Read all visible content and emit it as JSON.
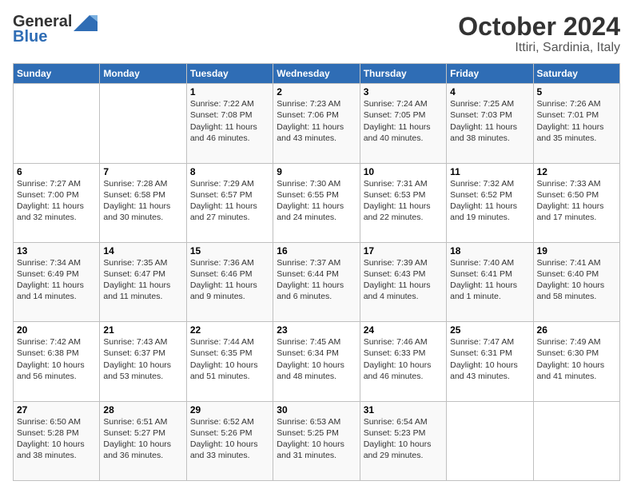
{
  "header": {
    "logo_line1": "General",
    "logo_line2": "Blue",
    "title": "October 2024",
    "subtitle": "Ittiri, Sardinia, Italy"
  },
  "weekdays": [
    "Sunday",
    "Monday",
    "Tuesday",
    "Wednesday",
    "Thursday",
    "Friday",
    "Saturday"
  ],
  "weeks": [
    [
      {
        "day": "",
        "info": ""
      },
      {
        "day": "",
        "info": ""
      },
      {
        "day": "1",
        "info": "Sunrise: 7:22 AM\nSunset: 7:08 PM\nDaylight: 11 hours and 46 minutes."
      },
      {
        "day": "2",
        "info": "Sunrise: 7:23 AM\nSunset: 7:06 PM\nDaylight: 11 hours and 43 minutes."
      },
      {
        "day": "3",
        "info": "Sunrise: 7:24 AM\nSunset: 7:05 PM\nDaylight: 11 hours and 40 minutes."
      },
      {
        "day": "4",
        "info": "Sunrise: 7:25 AM\nSunset: 7:03 PM\nDaylight: 11 hours and 38 minutes."
      },
      {
        "day": "5",
        "info": "Sunrise: 7:26 AM\nSunset: 7:01 PM\nDaylight: 11 hours and 35 minutes."
      }
    ],
    [
      {
        "day": "6",
        "info": "Sunrise: 7:27 AM\nSunset: 7:00 PM\nDaylight: 11 hours and 32 minutes."
      },
      {
        "day": "7",
        "info": "Sunrise: 7:28 AM\nSunset: 6:58 PM\nDaylight: 11 hours and 30 minutes."
      },
      {
        "day": "8",
        "info": "Sunrise: 7:29 AM\nSunset: 6:57 PM\nDaylight: 11 hours and 27 minutes."
      },
      {
        "day": "9",
        "info": "Sunrise: 7:30 AM\nSunset: 6:55 PM\nDaylight: 11 hours and 24 minutes."
      },
      {
        "day": "10",
        "info": "Sunrise: 7:31 AM\nSunset: 6:53 PM\nDaylight: 11 hours and 22 minutes."
      },
      {
        "day": "11",
        "info": "Sunrise: 7:32 AM\nSunset: 6:52 PM\nDaylight: 11 hours and 19 minutes."
      },
      {
        "day": "12",
        "info": "Sunrise: 7:33 AM\nSunset: 6:50 PM\nDaylight: 11 hours and 17 minutes."
      }
    ],
    [
      {
        "day": "13",
        "info": "Sunrise: 7:34 AM\nSunset: 6:49 PM\nDaylight: 11 hours and 14 minutes."
      },
      {
        "day": "14",
        "info": "Sunrise: 7:35 AM\nSunset: 6:47 PM\nDaylight: 11 hours and 11 minutes."
      },
      {
        "day": "15",
        "info": "Sunrise: 7:36 AM\nSunset: 6:46 PM\nDaylight: 11 hours and 9 minutes."
      },
      {
        "day": "16",
        "info": "Sunrise: 7:37 AM\nSunset: 6:44 PM\nDaylight: 11 hours and 6 minutes."
      },
      {
        "day": "17",
        "info": "Sunrise: 7:39 AM\nSunset: 6:43 PM\nDaylight: 11 hours and 4 minutes."
      },
      {
        "day": "18",
        "info": "Sunrise: 7:40 AM\nSunset: 6:41 PM\nDaylight: 11 hours and 1 minute."
      },
      {
        "day": "19",
        "info": "Sunrise: 7:41 AM\nSunset: 6:40 PM\nDaylight: 10 hours and 58 minutes."
      }
    ],
    [
      {
        "day": "20",
        "info": "Sunrise: 7:42 AM\nSunset: 6:38 PM\nDaylight: 10 hours and 56 minutes."
      },
      {
        "day": "21",
        "info": "Sunrise: 7:43 AM\nSunset: 6:37 PM\nDaylight: 10 hours and 53 minutes."
      },
      {
        "day": "22",
        "info": "Sunrise: 7:44 AM\nSunset: 6:35 PM\nDaylight: 10 hours and 51 minutes."
      },
      {
        "day": "23",
        "info": "Sunrise: 7:45 AM\nSunset: 6:34 PM\nDaylight: 10 hours and 48 minutes."
      },
      {
        "day": "24",
        "info": "Sunrise: 7:46 AM\nSunset: 6:33 PM\nDaylight: 10 hours and 46 minutes."
      },
      {
        "day": "25",
        "info": "Sunrise: 7:47 AM\nSunset: 6:31 PM\nDaylight: 10 hours and 43 minutes."
      },
      {
        "day": "26",
        "info": "Sunrise: 7:49 AM\nSunset: 6:30 PM\nDaylight: 10 hours and 41 minutes."
      }
    ],
    [
      {
        "day": "27",
        "info": "Sunrise: 6:50 AM\nSunset: 5:28 PM\nDaylight: 10 hours and 38 minutes."
      },
      {
        "day": "28",
        "info": "Sunrise: 6:51 AM\nSunset: 5:27 PM\nDaylight: 10 hours and 36 minutes."
      },
      {
        "day": "29",
        "info": "Sunrise: 6:52 AM\nSunset: 5:26 PM\nDaylight: 10 hours and 33 minutes."
      },
      {
        "day": "30",
        "info": "Sunrise: 6:53 AM\nSunset: 5:25 PM\nDaylight: 10 hours and 31 minutes."
      },
      {
        "day": "31",
        "info": "Sunrise: 6:54 AM\nSunset: 5:23 PM\nDaylight: 10 hours and 29 minutes."
      },
      {
        "day": "",
        "info": ""
      },
      {
        "day": "",
        "info": ""
      }
    ]
  ]
}
